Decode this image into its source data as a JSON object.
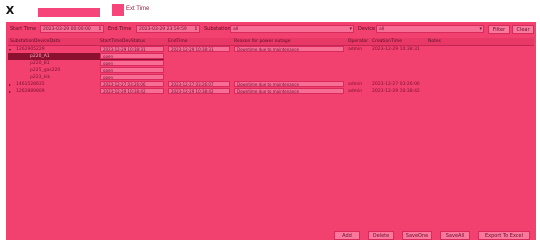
{
  "window": {
    "close_glyph": "X",
    "title": "Ext Time"
  },
  "filter": {
    "start_label": "Start Time",
    "start_value": "2023-03-29 00:00:00",
    "end_label": "End Time",
    "end_value": "2023-03-29 23:59:59",
    "substation_label": "Substation",
    "substation_value": "all",
    "device_label": "Device",
    "device_value": "all",
    "filter_button": "Filter",
    "clear_button": "Clear"
  },
  "table": {
    "columns": [
      "SubstationDeviceData",
      "StartTimeDevStatus",
      "EndTime",
      "Reason for power outage",
      "Operator",
      "CreationTime",
      "Notes"
    ],
    "rows": [
      {
        "id": "1262905229",
        "start": "2023-12-29 10:38:31",
        "end": "2023-12-29 10:38:31",
        "reason": "Downtime due to maintenance",
        "operator": "admin",
        "created": "2023-12-29 10:38:31"
      },
      {
        "id": "p220_A1",
        "status": "open",
        "selected": true
      },
      {
        "id": "p220_B1",
        "status": "open"
      },
      {
        "id": "p225_gas220",
        "status": "open"
      },
      {
        "id": "p223_kik",
        "status": "open"
      },
      {
        "id": "1461528635",
        "start": "2023-12-27 03:26:06",
        "end": "2023-12-27 03:26:07",
        "reason": "Downtime due to maintenance",
        "operator": "admin",
        "created": "2023-12-27 03:26:06"
      },
      {
        "id": "1262889809",
        "start": "2023-12-29 10:38:42",
        "end": "2023-12-29 10:38:42",
        "reason": "Downtime due to maintenance",
        "operator": "admin",
        "created": "2023-12-29 10:38:42"
      }
    ]
  },
  "actions": {
    "add": "Add",
    "delete": "Delete",
    "save_one": "SaveOne",
    "save_all": "SaveAll",
    "export": "Export To Excel"
  },
  "colors": {
    "panel": "#f2406f",
    "selected_row": "#8c1030"
  }
}
